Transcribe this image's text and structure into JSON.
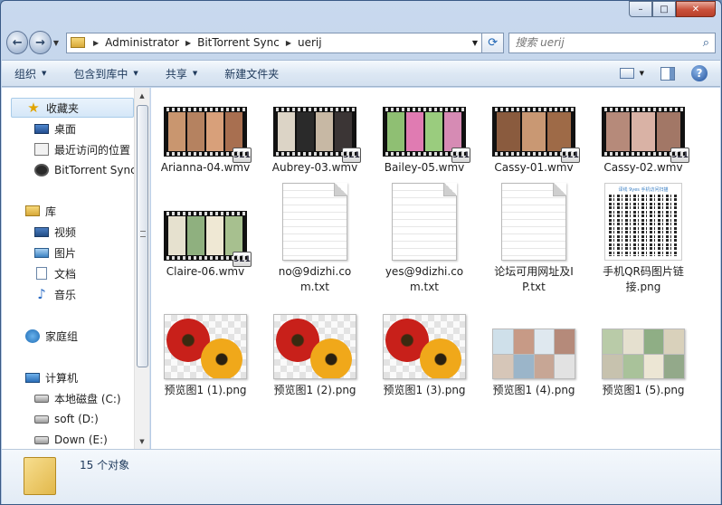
{
  "window": {
    "caption": {
      "minimize": "–",
      "maximize": "□",
      "close": "✕"
    }
  },
  "address": {
    "crumbs": [
      "Administrator",
      "BitTorrent Sync",
      "uerij"
    ],
    "search_placeholder": "搜索 uerij"
  },
  "toolbar": {
    "organize": "组织",
    "include_in_library": "包含到库中",
    "share": "共享",
    "new_folder": "新建文件夹"
  },
  "nav": {
    "favorites": "收藏夹",
    "desktop": "桌面",
    "recent": "最近访问的位置",
    "bittorrent": "BitTorrent Sync",
    "libraries": "库",
    "videos": "视频",
    "pictures": "图片",
    "documents": "文档",
    "music": "音乐",
    "homegroup": "家庭组",
    "computer": "计算机",
    "drive_c": "本地磁盘 (C:)",
    "drive_d": "soft (D:)",
    "drive_e": "Down (E:)"
  },
  "files": [
    {
      "name": "Arianna-04.wmv",
      "type": "video",
      "colors": [
        "#c9966f",
        "#b58260",
        "#d8a07a",
        "#a86f50"
      ]
    },
    {
      "name": "Aubrey-03.wmv",
      "type": "video",
      "colors": [
        "#dcd4c6",
        "#2a2a2a",
        "#c7b8a4",
        "#3b3535"
      ]
    },
    {
      "name": "Bailey-05.wmv",
      "type": "video",
      "colors": [
        "#8fbf73",
        "#e07bb2",
        "#9acc7e",
        "#d68bb4"
      ]
    },
    {
      "name": "Cassy-01.wmv",
      "type": "video",
      "colors": [
        "#8a5b3e",
        "#c99873",
        "#9e6a47"
      ]
    },
    {
      "name": "Cassy-02.wmv",
      "type": "video",
      "colors": [
        "#b68a7a",
        "#d9b2a5",
        "#a27766"
      ]
    },
    {
      "name": "Claire-06.wmv",
      "type": "video",
      "colors": [
        "#e6e1cf",
        "#8fb07f",
        "#efe8d4",
        "#a7c08f"
      ]
    },
    {
      "name": "no@9dizhi.com.txt",
      "type": "text"
    },
    {
      "name": "yes@9dizhi.com.txt",
      "type": "text"
    },
    {
      "name": "论坛可用网址及IP.txt",
      "type": "text"
    },
    {
      "name": "手机QR码图片链接.png",
      "type": "qr",
      "caption": "译线 9yes 手机访问扫描"
    },
    {
      "name": "预览图1 (1).png",
      "type": "flower"
    },
    {
      "name": "预览图1 (2).png",
      "type": "flower"
    },
    {
      "name": "预览图1 (3).png",
      "type": "flower"
    },
    {
      "name": "预览图1 (4).png",
      "type": "collage",
      "colors": [
        "#cfe0ea",
        "#c79a86",
        "#dfe8ef",
        "#b58a7a",
        "#d6c6b8",
        "#9bb5c9",
        "#c7a695",
        "#e2e2e2"
      ]
    },
    {
      "name": "预览图1 (5).png",
      "type": "collage",
      "colors": [
        "#b9cba8",
        "#e5e0cf",
        "#8fae85",
        "#d9d1bb",
        "#c7c2ae",
        "#a9c29a",
        "#ece6d4",
        "#93a98a"
      ]
    }
  ],
  "status": {
    "count_text": "15 个对象"
  },
  "colors": {
    "accent": "#1e395b",
    "window_frame": "#b9cde6",
    "close_button": "#c9503a"
  }
}
